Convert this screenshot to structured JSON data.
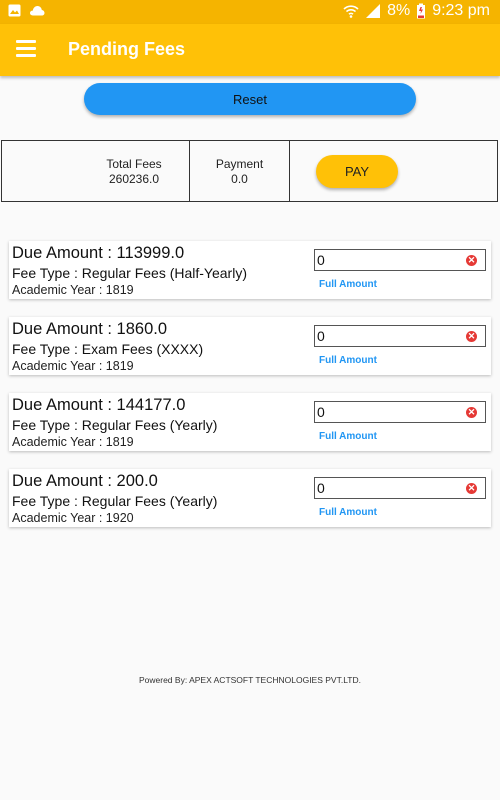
{
  "status_bar": {
    "battery": "8%",
    "time": "9:23 pm",
    "icons": [
      "gallery-icon",
      "cloud-icon",
      "wifi-icon",
      "signal-icon",
      "battery-icon"
    ]
  },
  "app_bar": {
    "title": "Pending Fees",
    "menu_icon": "hamburger-icon"
  },
  "reset": {
    "label": "Reset"
  },
  "summary": {
    "total_fees_label": "Total Fees",
    "total_fees_value": "260236.0",
    "payment_label": "Payment",
    "payment_value": "0.0",
    "pay_label": "PAY"
  },
  "fees": [
    {
      "due_amount": "Due Amount : 113999.0",
      "fee_type": "Fee Type : Regular Fees (Half-Yearly)",
      "academic_year": "Academic Year : 1819",
      "input_value": "0",
      "full_amount_label": "Full Amount"
    },
    {
      "due_amount": "Due Amount : 1860.0",
      "fee_type": "Fee Type : Exam Fees (XXXX)",
      "academic_year": "Academic Year : 1819",
      "input_value": "0",
      "full_amount_label": "Full Amount"
    },
    {
      "due_amount": "Due Amount : 144177.0",
      "fee_type": "Fee Type : Regular Fees (Yearly)",
      "academic_year": "Academic Year : 1819",
      "input_value": "0",
      "full_amount_label": "Full Amount"
    },
    {
      "due_amount": "Due Amount : 200.0",
      "fee_type": "Fee Type : Regular Fees (Yearly)",
      "academic_year": "Academic Year : 1920",
      "input_value": "0",
      "full_amount_label": "Full Amount"
    }
  ],
  "footer": {
    "text": "Powered By: APEX ACTSOFT TECHNOLOGIES PVT.LTD."
  },
  "colors": {
    "status_bar": "#f5b400",
    "app_bar": "#ffc107",
    "reset_button": "#2196f3",
    "pay_button": "#ffc107",
    "full_amount_link": "#2196f3",
    "clear_icon": "#e53935"
  }
}
